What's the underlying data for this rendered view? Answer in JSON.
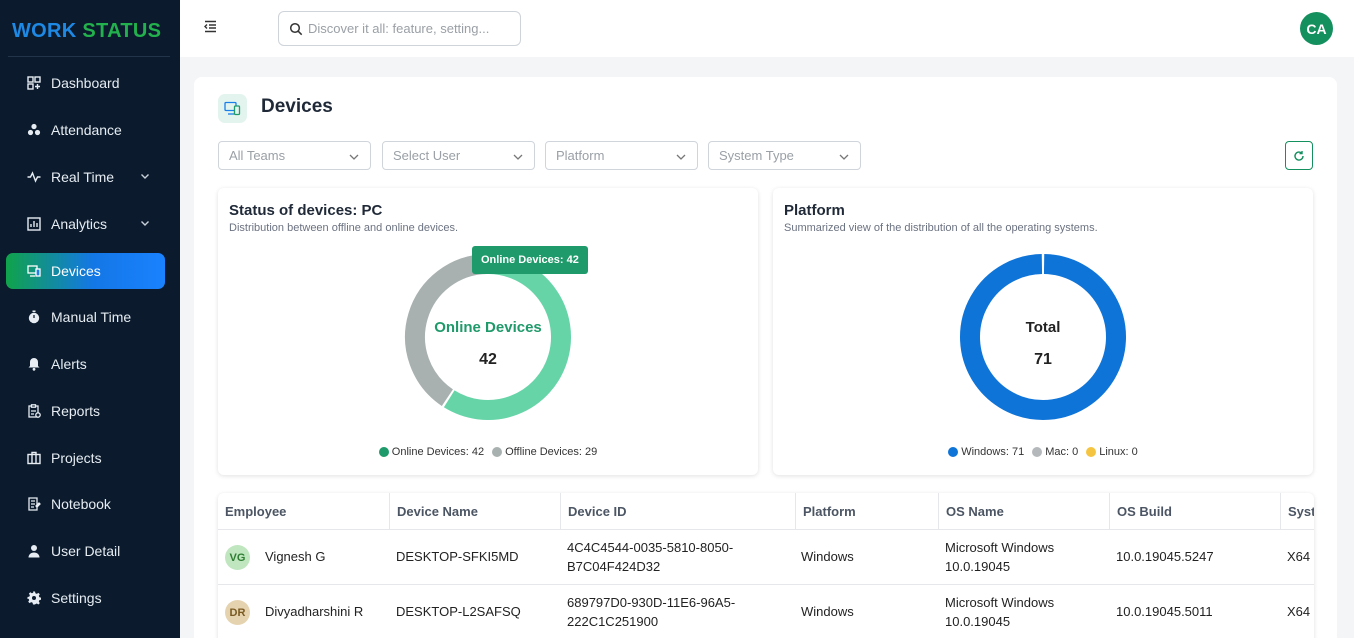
{
  "app": {
    "logo_part1": "WORK",
    "logo_part2": "STATUS"
  },
  "sidebar": {
    "items": [
      {
        "label": "Dashboard"
      },
      {
        "label": "Attendance"
      },
      {
        "label": "Real Time"
      },
      {
        "label": "Analytics"
      },
      {
        "label": "Devices"
      },
      {
        "label": "Manual Time"
      },
      {
        "label": "Alerts"
      },
      {
        "label": "Reports"
      },
      {
        "label": "Projects"
      },
      {
        "label": "Notebook"
      },
      {
        "label": "User Detail"
      },
      {
        "label": "Settings"
      }
    ],
    "active": "Devices"
  },
  "topbar": {
    "search_placeholder": "Discover it all: feature, setting...",
    "avatar_initials": "CA"
  },
  "page": {
    "title": "Devices"
  },
  "filters": {
    "teams": "All Teams",
    "user": "Select User",
    "platform": "Platform",
    "system_type": "System Type"
  },
  "colors": {
    "online": "#67d4a8",
    "offline": "#a8b0b0",
    "online_dot": "#1f9a6a",
    "windows": "#0f74d8",
    "mac": "#b5b8bb",
    "linux": "#f5c542",
    "accent": "#148f5e"
  },
  "chart_data": [
    {
      "type": "pie",
      "title": "Status of devices: PC",
      "subtitle": "Distribution between offline and online devices.",
      "categories": [
        "Online Devices",
        "Offline Devices"
      ],
      "values": [
        42,
        29
      ],
      "center_label": "Online Devices",
      "center_value": "42",
      "tooltip_label": "Online Devices:",
      "tooltip_value": "42",
      "legend": [
        "Online Devices: 42",
        "Offline Devices: 29"
      ]
    },
    {
      "type": "pie",
      "title": "Platform",
      "subtitle": "Summarized view of the distribution of all the operating systems.",
      "categories": [
        "Windows",
        "Mac",
        "Linux"
      ],
      "values": [
        71,
        0,
        0
      ],
      "center_label": "Total",
      "center_value": "71",
      "legend": [
        "Windows: 71",
        "Mac: 0",
        "Linux: 0"
      ]
    }
  ],
  "table": {
    "columns": [
      "Employee",
      "Device Name",
      "Device ID",
      "Platform",
      "OS Name",
      "OS Build",
      "Syst"
    ],
    "rows": [
      {
        "initials": "VG",
        "employee": "Vignesh G",
        "device_name": "DESKTOP-SFKI5MD",
        "device_id_1": "4C4C4544-0035-5810-8050-",
        "device_id_2": "B7C04F424D32",
        "platform": "Windows",
        "os_name_1": "Microsoft Windows",
        "os_name_2": "10.0.19045",
        "os_build": "10.0.19045.5247",
        "system": "X64"
      },
      {
        "initials": "DR",
        "employee": "Divyadharshini R",
        "device_name": "DESKTOP-L2SAFSQ",
        "device_id_1": "689797D0-930D-11E6-96A5-",
        "device_id_2": "222C1C251900",
        "platform": "Windows",
        "os_name_1": "Microsoft Windows",
        "os_name_2": "10.0.19045",
        "os_build": "10.0.19045.5011",
        "system": "X64"
      }
    ]
  }
}
